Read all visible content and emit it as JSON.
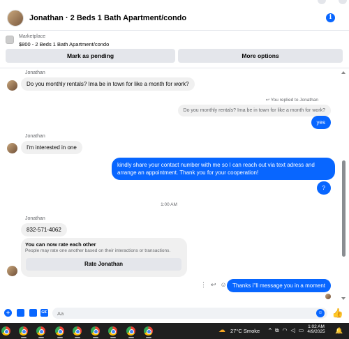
{
  "header": {
    "title": "Jonathan · 2 Beds 1 Bath Apartment/condo",
    "info_icon": "info-icon"
  },
  "listing": {
    "label": "Marketplace",
    "title": "$800 - 2 Beds 1 Bath Apartment/condo",
    "mark_pending_label": "Mark as pending",
    "more_options_label": "More options"
  },
  "chat": {
    "sender_name": "Jonathan",
    "msg1": "Do you monthly rentals? Ima be in town for like a month for work?",
    "replied_label": "You replied to Jonathan",
    "reply_quote": "Do you monthly rentals? Ima be in town for like a month for work?",
    "reply_text": "yes",
    "msg2": "I'm interested in one",
    "out_msg": "kindly share your contact number with me so I can reach out via text adress and arrange an appointment. Thank you for your cooperation!",
    "out_q": "?",
    "timestamp": "1:00 AM",
    "phone": "832-571-4062",
    "rate_title": "You can now rate each other",
    "rate_sub": "People may rate one another based on their interactions or transactions.",
    "rate_button": "Rate Jonathan",
    "last_msg": "Thanks i''ll message you in a moment"
  },
  "composer": {
    "placeholder": "Aa"
  },
  "taskbar": {
    "weather": "27°C  Smoke",
    "time": "1:02 AM",
    "date": "4/9/2025",
    "brand_color": "#0866ff"
  }
}
